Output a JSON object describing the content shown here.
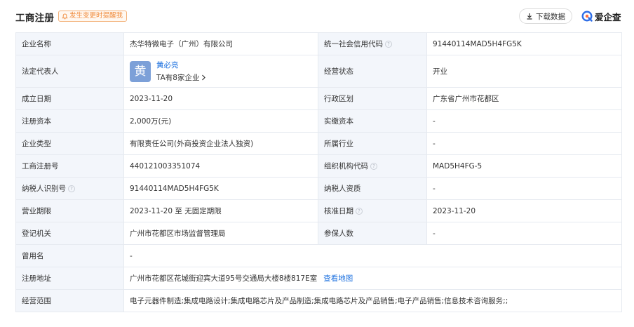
{
  "header": {
    "title": "工商注册",
    "notify_tag": "发生变更时提醒我",
    "download_label": "下载数据",
    "brand_name": "爱企查"
  },
  "colors": {
    "accent_blue": "#1a6fdf",
    "label_bg": "#f3f6fb",
    "border": "#e6eaf0",
    "notify_orange": "#f08a3a"
  },
  "rows": {
    "company_name": {
      "label": "企业名称",
      "value": "杰华特微电子（广州）有限公司"
    },
    "credit_code": {
      "label": "统一社会信用代码",
      "value": "91440114MAD5H4FG5K"
    },
    "legal_rep": {
      "label": "法定代表人",
      "avatar_char": "黄",
      "name": "黄必亮",
      "more": "TA有8家企业"
    },
    "status": {
      "label": "经营状态",
      "value": "开业"
    },
    "founded": {
      "label": "成立日期",
      "value": "2023-11-20"
    },
    "region": {
      "label": "行政区划",
      "value": "广东省广州市花都区"
    },
    "reg_capital": {
      "label": "注册资本",
      "value": "2,000万(元)"
    },
    "paid_capital": {
      "label": "实缴资本",
      "value": "-"
    },
    "company_type": {
      "label": "企业类型",
      "value": "有限责任公司(外商投资企业法人独资)"
    },
    "industry": {
      "label": "所属行业",
      "value": "-"
    },
    "reg_no": {
      "label": "工商注册号",
      "value": "440121003351074"
    },
    "org_code": {
      "label": "组织机构代码",
      "value": "MAD5H4FG-5"
    },
    "taxpayer_id": {
      "label": "纳税人识别号",
      "value": "91440114MAD5H4FG5K"
    },
    "taxpayer_qual": {
      "label": "纳税人资质",
      "value": "-"
    },
    "biz_term": {
      "label": "营业期限",
      "value": "2023-11-20 至 无固定期限"
    },
    "approval_date": {
      "label": "核准日期",
      "value": "2023-11-20"
    },
    "reg_authority": {
      "label": "登记机关",
      "value": "广州市花都区市场监督管理局"
    },
    "insured": {
      "label": "参保人数",
      "value": "-"
    },
    "former_name": {
      "label": "曾用名",
      "value": "-"
    },
    "address": {
      "label": "注册地址",
      "value": "广州市花都区花城街迎宾大道95号交通局大楼8楼817E室",
      "link": "查看地图"
    },
    "scope": {
      "label": "经营范围",
      "value": "电子元器件制造;集成电路设计;集成电路芯片及产品制造;集成电路芯片及产品销售;电子产品销售;信息技术咨询服务;;"
    }
  }
}
